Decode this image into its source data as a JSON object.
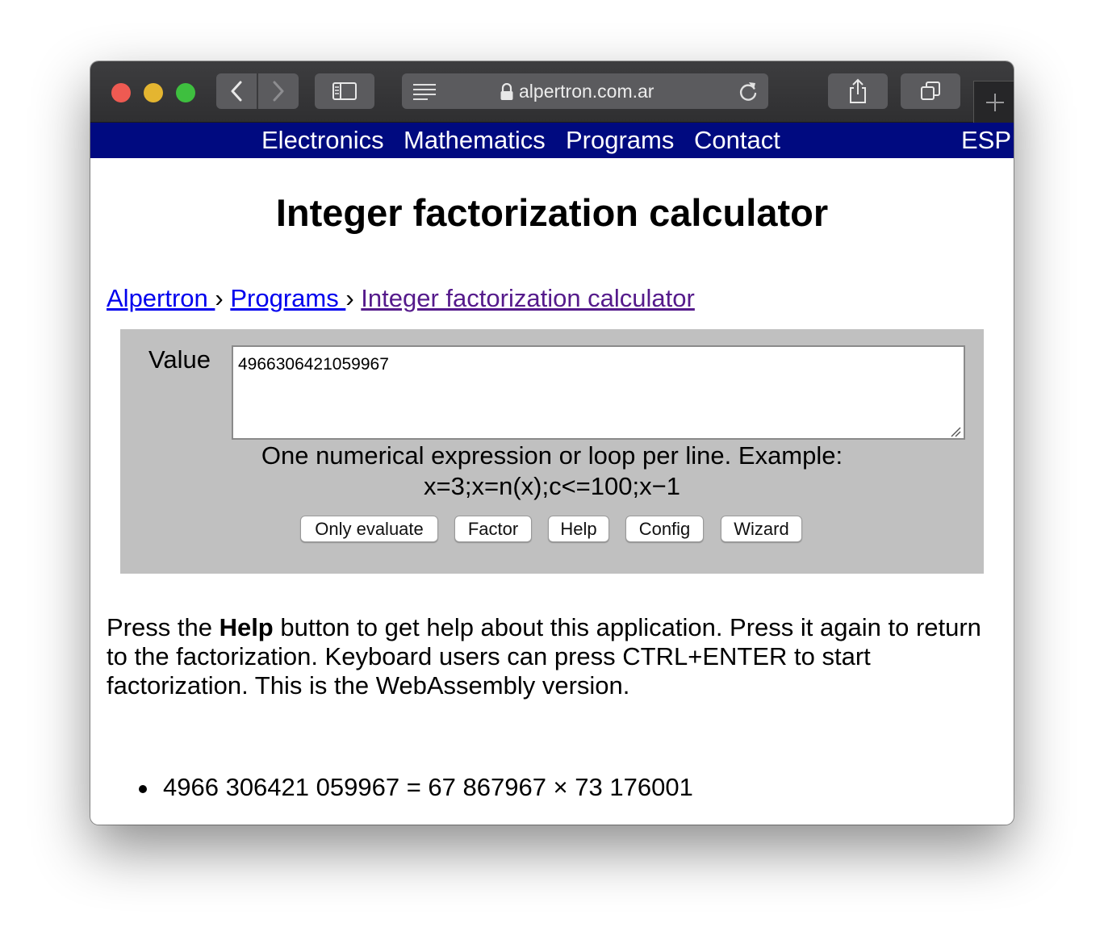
{
  "browser": {
    "address": "alpertron.com.ar"
  },
  "topnav": {
    "items": [
      "Electronics",
      "Mathematics",
      "Programs",
      "Contact"
    ],
    "lang": "ESP"
  },
  "page": {
    "title": "Integer factorization calculator"
  },
  "breadcrumb": {
    "items": [
      "Alpertron ",
      "Programs ",
      "Integer factorization calculator"
    ],
    "separator": "›"
  },
  "calculator": {
    "value_label": "Value",
    "value": "4966306421059967",
    "hint_line1": "One numerical expression or loop per line. Example:",
    "hint_line2": "x=3;x=n(x);c<=100;x−1",
    "buttons": {
      "only_evaluate": "Only evaluate",
      "factor": "Factor",
      "help": "Help",
      "config": "Config",
      "wizard": "Wizard"
    }
  },
  "help": {
    "prefix": "Press the ",
    "bold": "Help",
    "suffix": " button to get help about this application. Press it again to return to the factorization. Keyboard users can press CTRL+ENTER to start factorization. This is the WebAssembly version."
  },
  "results": [
    "4966 306421 059967 = 67 867967 × 73 176001"
  ],
  "colors": {
    "nav_background": "#000a80",
    "calc_background": "#c0c0c0",
    "link": "#0000ee",
    "visited_link": "#551a8b"
  }
}
